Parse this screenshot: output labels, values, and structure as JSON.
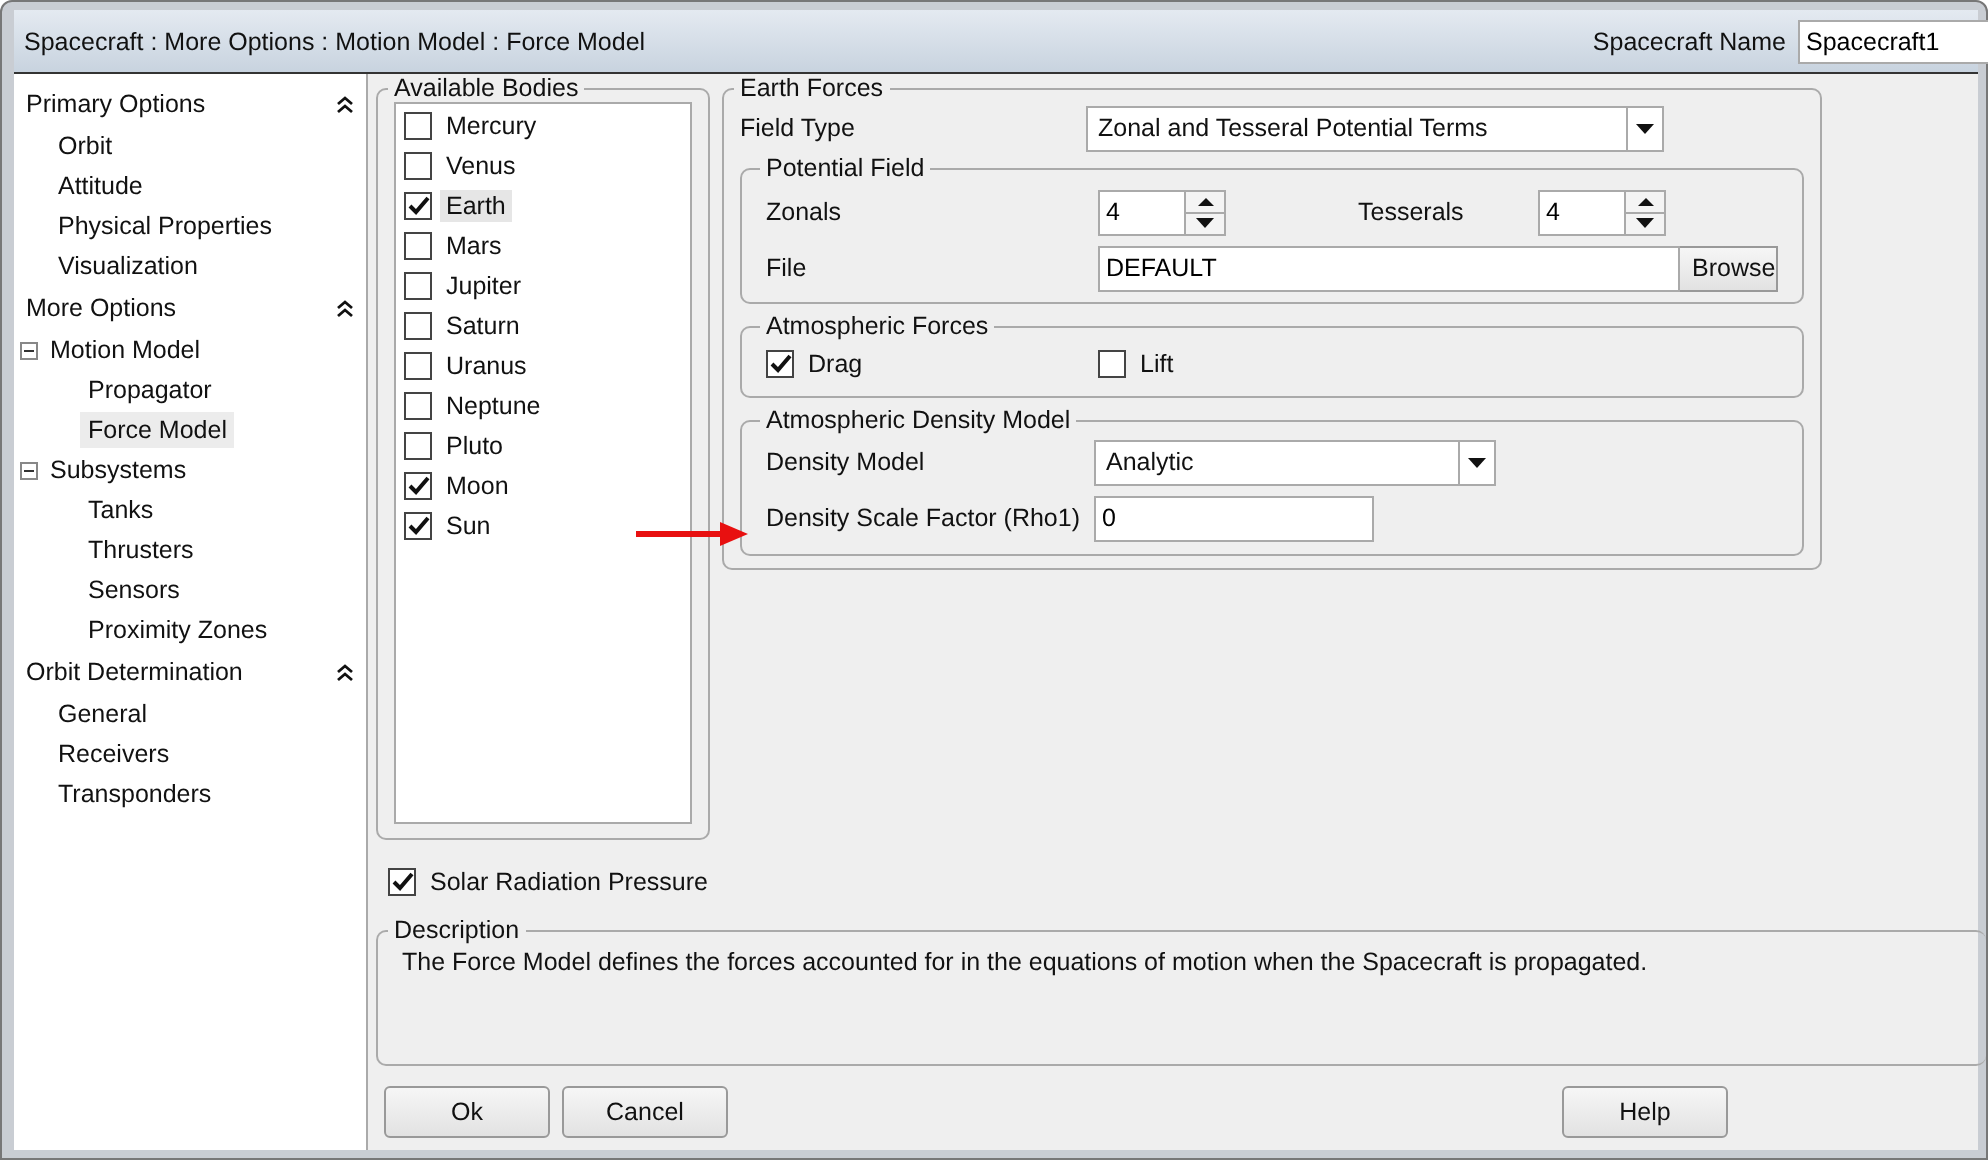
{
  "window": {
    "title": "Spacecraft : More Options : Motion Model : Force Model",
    "name_label": "Spacecraft Name",
    "name_value": "Spacecraft1"
  },
  "sidebar": {
    "sections": [
      {
        "title": "Primary Options",
        "expanded": true,
        "items": [
          {
            "label": "Orbit",
            "selected": false
          },
          {
            "label": "Attitude",
            "selected": false
          },
          {
            "label": "Physical Properties",
            "selected": false
          },
          {
            "label": "Visualization",
            "selected": false
          }
        ]
      },
      {
        "title": "More Options",
        "expanded": true,
        "items": [
          {
            "label": "Motion Model",
            "selected": false,
            "expanded": true,
            "children": [
              {
                "label": "Propagator",
                "selected": false
              },
              {
                "label": "Force Model",
                "selected": true
              }
            ]
          },
          {
            "label": "Subsystems",
            "selected": false,
            "expanded": true,
            "children": [
              {
                "label": "Tanks",
                "selected": false
              },
              {
                "label": "Thrusters",
                "selected": false
              },
              {
                "label": "Sensors",
                "selected": false
              },
              {
                "label": "Proximity Zones",
                "selected": false
              }
            ]
          }
        ]
      },
      {
        "title": "Orbit Determination",
        "expanded": true,
        "items": [
          {
            "label": "General",
            "selected": false
          },
          {
            "label": "Receivers",
            "selected": false
          },
          {
            "label": "Transponders",
            "selected": false
          }
        ]
      }
    ]
  },
  "available_bodies": {
    "title": "Available Bodies",
    "items": [
      {
        "label": "Mercury",
        "checked": false,
        "selected": false
      },
      {
        "label": "Venus",
        "checked": false,
        "selected": false
      },
      {
        "label": "Earth",
        "checked": true,
        "selected": true
      },
      {
        "label": "Mars",
        "checked": false,
        "selected": false
      },
      {
        "label": "Jupiter",
        "checked": false,
        "selected": false
      },
      {
        "label": "Saturn",
        "checked": false,
        "selected": false
      },
      {
        "label": "Uranus",
        "checked": false,
        "selected": false
      },
      {
        "label": "Neptune",
        "checked": false,
        "selected": false
      },
      {
        "label": "Pluto",
        "checked": false,
        "selected": false
      },
      {
        "label": "Moon",
        "checked": true,
        "selected": false
      },
      {
        "label": "Sun",
        "checked": true,
        "selected": false
      }
    ]
  },
  "earth_forces": {
    "title": "Earth Forces",
    "field_type_label": "Field Type",
    "field_type_value": "Zonal and Tesseral Potential Terms",
    "potential_field": {
      "title": "Potential Field",
      "zonals_label": "Zonals",
      "zonals_value": "4",
      "tesserals_label": "Tesserals",
      "tesserals_value": "4",
      "file_label": "File",
      "file_value": "DEFAULT",
      "browse_button": "Browse"
    },
    "atmospheric_forces": {
      "title": "Atmospheric Forces",
      "drag": {
        "label": "Drag",
        "checked": true
      },
      "lift": {
        "label": "Lift",
        "checked": false
      }
    },
    "atmospheric_density": {
      "title": "Atmospheric Density Model",
      "density_model_label": "Density Model",
      "density_model_value": "Analytic",
      "scale_factor_label": "Density Scale Factor (Rho1)",
      "scale_factor_value": "0"
    }
  },
  "solar_radiation_pressure": {
    "label": "Solar Radiation Pressure",
    "checked": true
  },
  "description": {
    "title": "Description",
    "text": "The Force Model defines the forces accounted for in the equations of motion when the Spacecraft is propagated."
  },
  "buttons": {
    "ok": "Ok",
    "cancel": "Cancel",
    "help": "Help"
  }
}
